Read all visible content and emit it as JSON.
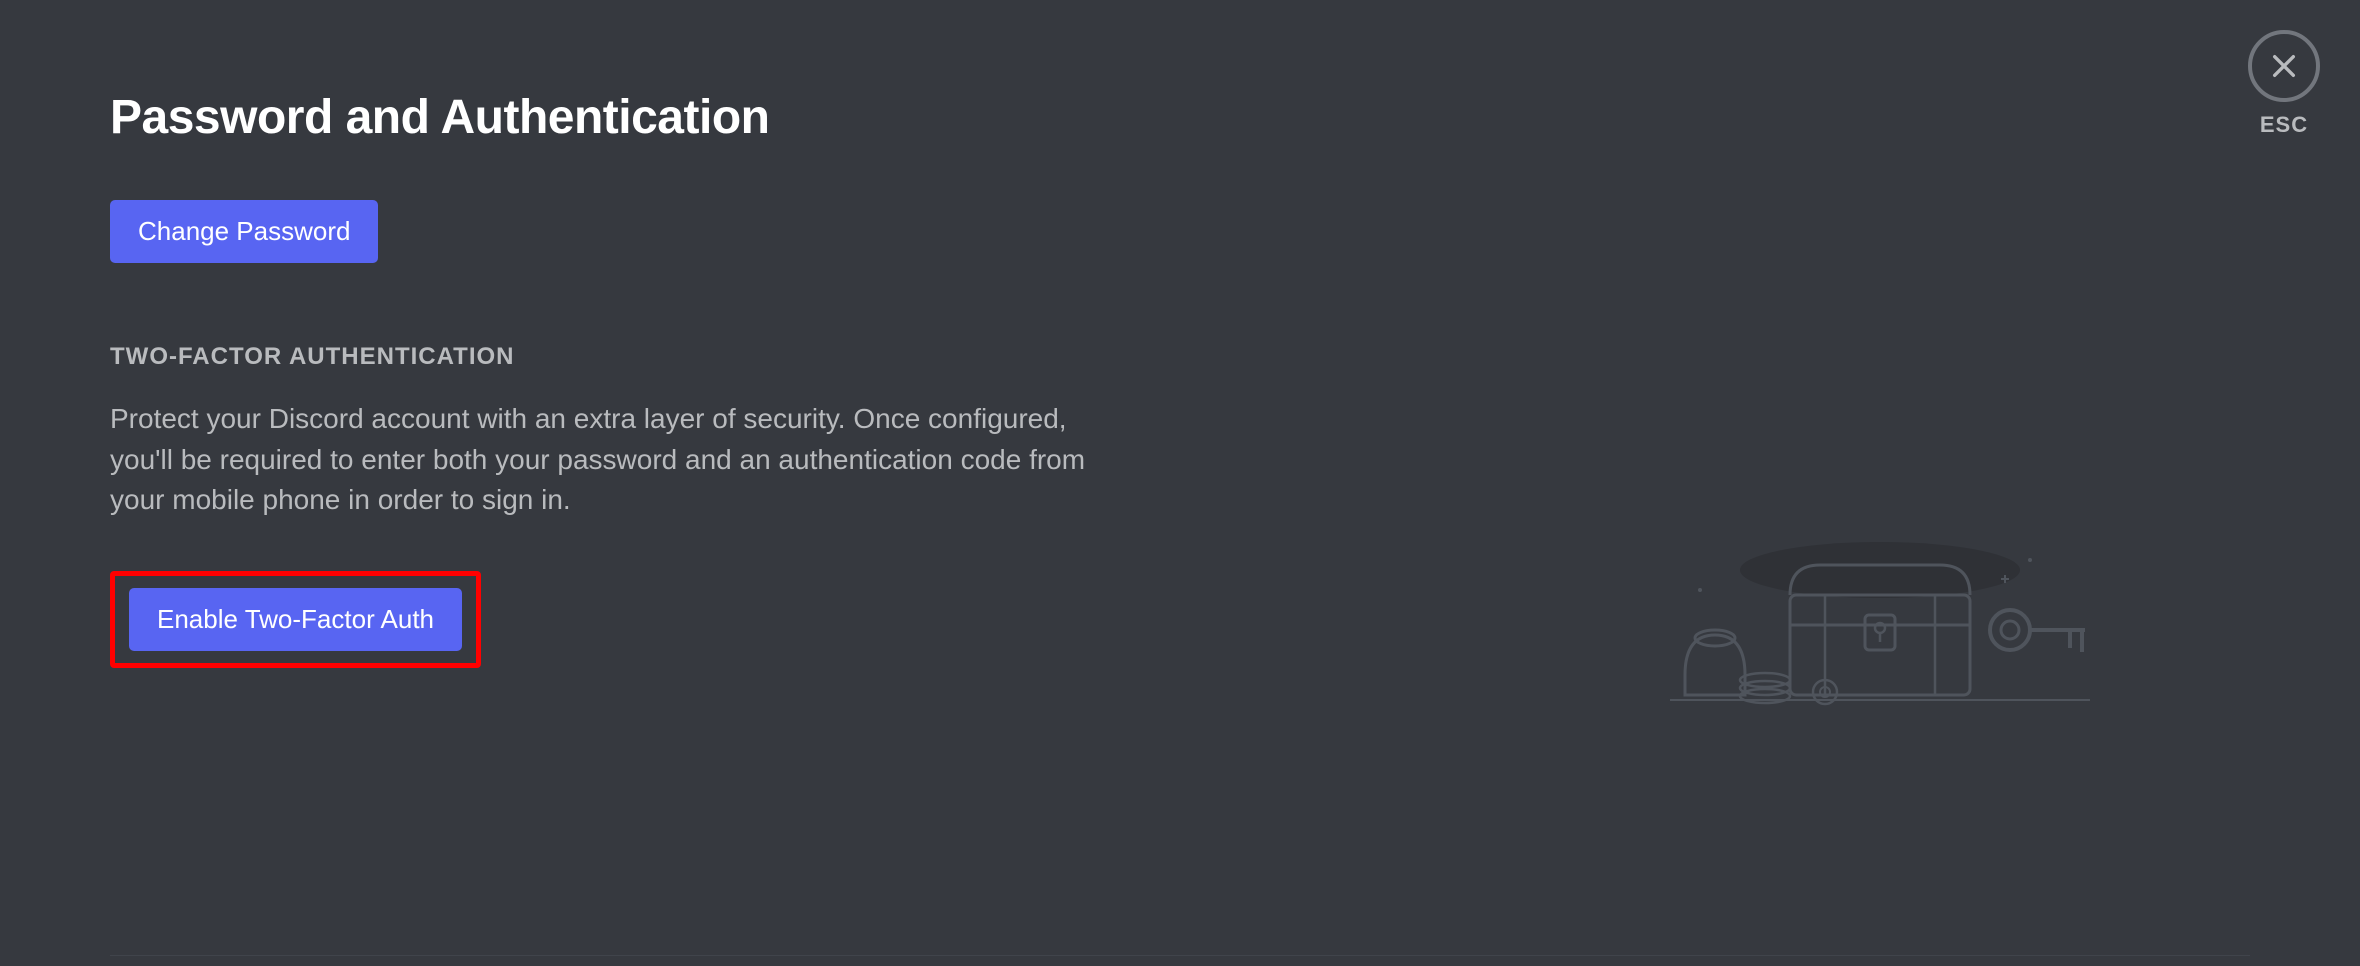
{
  "header": {
    "title": "Password and Authentication",
    "close_label": "ESC"
  },
  "buttons": {
    "change_password": "Change Password",
    "enable_2fa": "Enable Two-Factor Auth"
  },
  "two_factor": {
    "section_title": "TWO-FACTOR AUTHENTICATION",
    "description": "Protect your Discord account with an extra layer of security. Once configured, you'll be required to enter both your password and an authentication code from your mobile phone in order to sign in."
  },
  "colors": {
    "accent": "#5865f2",
    "background": "#36393f",
    "text_muted": "#b9bbbe",
    "highlight_border": "#ff0000"
  }
}
